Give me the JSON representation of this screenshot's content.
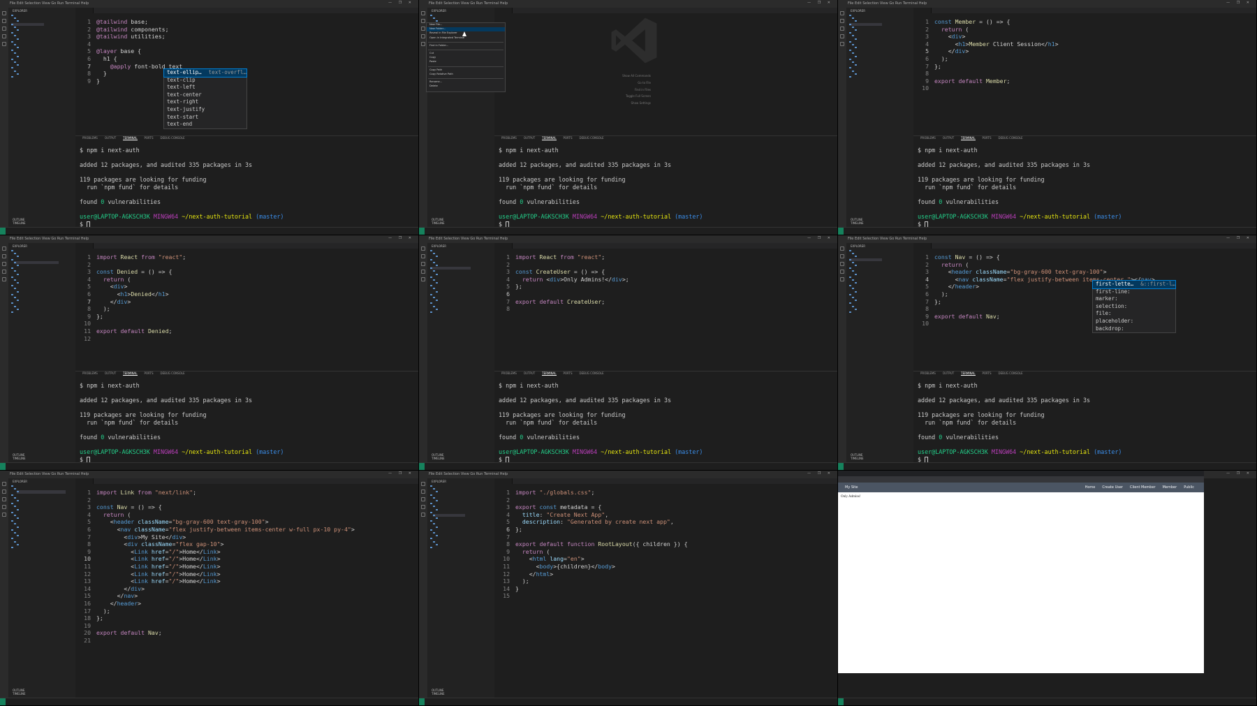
{
  "window": {
    "menu": "File  Edit  Selection  View  Go  Run  Terminal  Help",
    "controls": "—  ❐  ✕"
  },
  "sidebar": {
    "title": "EXPLORER",
    "outline": "OUTLINE",
    "timeline": "TIMELINE"
  },
  "panel_tabs": [
    "PROBLEMS",
    "OUTPUT",
    "TERMINAL",
    "PORTS",
    "DEBUG CONSOLE"
  ],
  "terminal": {
    "cmd": "$ npm i next-auth",
    "added": "added 12 packages, and audited 335 packages in 3s",
    "funding1": "119 packages are looking for funding",
    "funding2": "  run `npm fund` for details",
    "found_pre": "found ",
    "found_num": "0",
    "found_post": " vulnerabilities",
    "user": "user@LAPTOP-AGKSCH3K",
    "shell": "MINGW64",
    "path": "~/next-auth-tutorial",
    "branch": "(master)",
    "prompt": "$"
  },
  "panels": {
    "p1": {
      "lines": [
        "@tailwind base;",
        "@tailwind components;",
        "@tailwind utilities;",
        "",
        "@layer base {",
        "  h1 {",
        "    @apply font-bold text",
        "  }",
        "}"
      ],
      "suggest": [
        "text-ellip…",
        "text-clip",
        "text-left",
        "text-center",
        "text-right",
        "text-justify",
        "text-start",
        "text-end"
      ],
      "suggest_hint": "text-overfl…"
    },
    "p2": {
      "menu": [
        "New File...",
        "New Folder...",
        "Reveal in File Explorer",
        "Open in Integrated Terminal",
        "Find in Folder...",
        "Cut",
        "Copy",
        "Paste",
        "Copy Path",
        "Copy Relative Path",
        "Rename...",
        "Delete"
      ],
      "welcome": [
        "Show All Commands",
        "Go to File",
        "Find in Files",
        "Toggle Full Screen",
        "Show Settings"
      ]
    },
    "p3": {
      "lines": [
        "const Member = () => {",
        "  return (",
        "    <div>",
        "      <h1>Member Client Session</h1>",
        "    </div>",
        "  );",
        "};",
        "",
        "export default Member;",
        ""
      ]
    },
    "p4": {
      "lines": [
        "import React from \"react\";",
        "",
        "const Denied = () => {",
        "  return (",
        "    <div>",
        "      <h1>Denied</h1>",
        "    </div>",
        "  );",
        "};",
        "",
        "export default Denied;",
        ""
      ]
    },
    "p5": {
      "lines": [
        "import React from \"react\";",
        "",
        "const CreateUser = () => {",
        "  return <div>Only Admins!</div>;",
        "};",
        "",
        "export default CreateUser;",
        ""
      ]
    },
    "p6": {
      "lines": [
        "const Nav = () => {",
        "  return (",
        "    <header className=\"bg-gray-600 text-gray-100\">",
        "      <nav className=\"flex justify-between items-center \"></nav>",
        "    </header>",
        "  );",
        "};",
        "",
        "export default Nav;",
        ""
      ],
      "suggest": [
        "first-lette…",
        "first-line:",
        "marker:",
        "selection:",
        "file:",
        "placeholder:",
        "backdrop:"
      ],
      "suggest_hint": "&::first-l…"
    },
    "p7": {
      "lines": [
        "import Link from \"next/link\";",
        "",
        "const Nav = () => {",
        "  return (",
        "    <header className=\"bg-gray-600 text-gray-100\">",
        "      <nav className=\"flex justify-between items-center w-full px-10 py-4\">",
        "        <div>My Site</div>",
        "        <div className=\"flex gap-10\">",
        "          <Link href=\"/\">Home</Link>",
        "          <Link href=\"/\">Home</Link>",
        "          <Link href=\"/\">Home</Link>",
        "          <Link href=\"/\">Home</Link>",
        "          <Link href=\"/\">Home</Link>",
        "        </div>",
        "      </nav>",
        "    </header>",
        "  );",
        "};",
        "",
        "export default Nav;",
        ""
      ]
    },
    "p8": {
      "lines": [
        "import \"./globals.css\";",
        "",
        "export const metadata = {",
        "  title: \"Create Next App\",",
        "  description: \"Generated by create next app\",",
        "};",
        "",
        "export default function RootLayout({ children }) {",
        "  return (",
        "    <html lang=\"en\">",
        "      <body>{children}</body>",
        "    </html>",
        "  );",
        "}",
        ""
      ]
    },
    "p9": {
      "site": "My Site",
      "nav": [
        "Home",
        "Create User",
        "Client Member",
        "Member",
        "Public"
      ],
      "body_text": "Only Admins!"
    }
  },
  "colors": {
    "header_bg": "#4b5563",
    "status_remote": "#16825d"
  }
}
